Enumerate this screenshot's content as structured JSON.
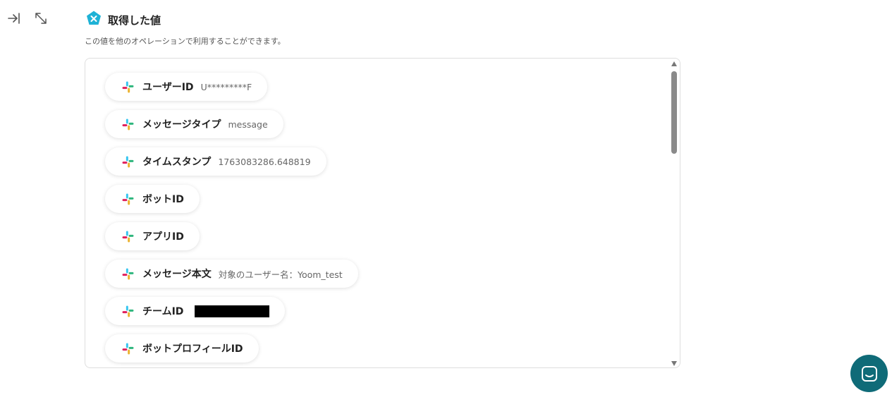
{
  "header": {
    "title": "取得した値",
    "subtitle": "この値を他のオペレーションで利用することができます。"
  },
  "toolbar": {
    "collapse_icon": "collapse-right-icon",
    "expand_icon": "expand-diagonal-icon"
  },
  "items": [
    {
      "label": "ユーザーID",
      "value": "U*********F"
    },
    {
      "label": "メッセージタイプ",
      "value": "message"
    },
    {
      "label": "タイムスタンプ",
      "value": "1763083286.648819"
    },
    {
      "label": "ボットID",
      "value": ""
    },
    {
      "label": "アプリID",
      "value": ""
    },
    {
      "label": "メッセージ本文",
      "value": "対象のユーザー名：Yoom_test"
    },
    {
      "label": "チームID",
      "value": "",
      "redacted": true
    },
    {
      "label": "ボットプロフィールID",
      "value": ""
    }
  ],
  "colors": {
    "accent": "#1fb2d6",
    "chat_button": "#0f6b78"
  }
}
